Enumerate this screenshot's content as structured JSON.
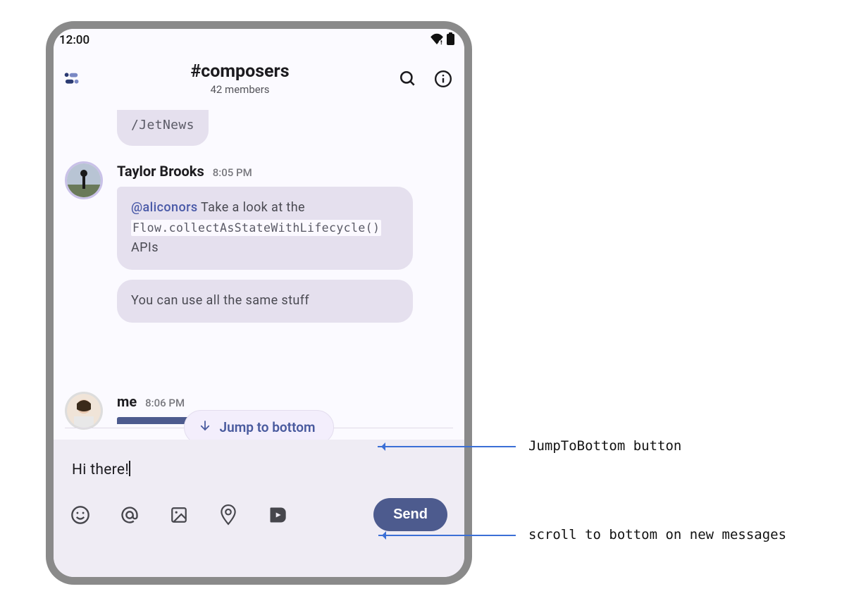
{
  "status": {
    "time": "12:00"
  },
  "header": {
    "channel_title": "#composers",
    "members_label": "42 members"
  },
  "messages": {
    "partial_top": "/JetNews",
    "m1": {
      "author": "Taylor Brooks",
      "time": "8:05 PM",
      "bubble1_mention": "@aliconors",
      "bubble1_text": " Take a look at the ",
      "bubble1_code": "Flow.collectAsStateWithLifecycle()",
      "bubble1_tail": " APIs",
      "bubble2": "You can use all the same stuff"
    },
    "jump_label": "Jump to bottom",
    "m2": {
      "author": "me",
      "time": "8:06 PM"
    }
  },
  "compose": {
    "draft": "Hi there!",
    "send_label": "Send"
  },
  "annotations": {
    "a1": "JumpToBottom button",
    "a2": "scroll to bottom on new messages"
  }
}
